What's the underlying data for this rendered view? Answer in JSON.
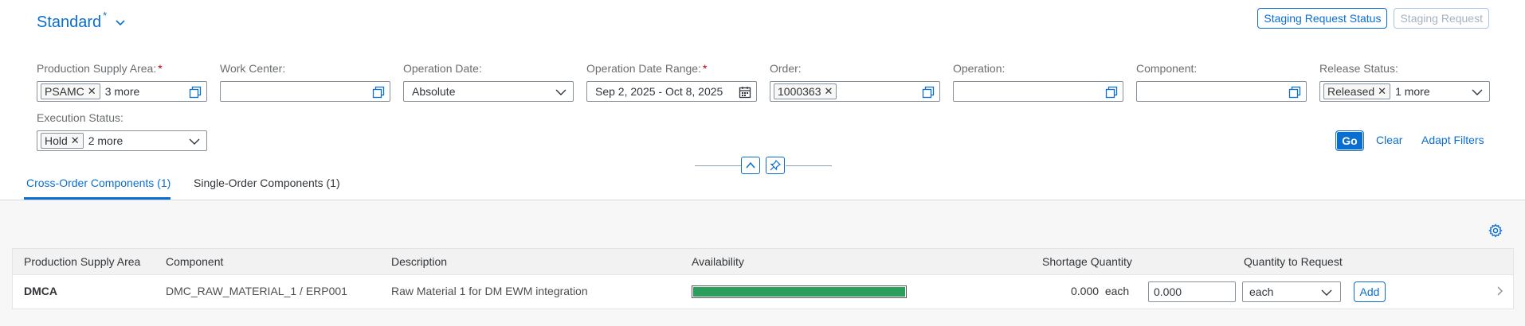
{
  "variant": {
    "title": "Standard",
    "dirty_marker": "*"
  },
  "top_actions": {
    "staging_status": "Staging Request Status",
    "staging_request": "Staging Request"
  },
  "filters": {
    "psa": {
      "label": "Production Supply Area:",
      "required": "*",
      "token": "PSAMC",
      "more": "3 more"
    },
    "work_center": {
      "label": "Work Center:",
      "value": ""
    },
    "op_date": {
      "label": "Operation Date:",
      "value": "Absolute"
    },
    "op_range": {
      "label": "Operation Date Range:",
      "required": "*",
      "value": "Sep 2, 2025 - Oct 8, 2025"
    },
    "order": {
      "label": "Order:",
      "token": "1000363"
    },
    "operation": {
      "label": "Operation:",
      "value": ""
    },
    "component": {
      "label": "Component:",
      "value": ""
    },
    "release": {
      "label": "Release Status:",
      "token": "Released",
      "more": "1 more"
    },
    "execution": {
      "label": "Execution Status:",
      "token": "Hold",
      "more": "2 more"
    }
  },
  "filter_actions": {
    "go": "Go",
    "clear": "Clear",
    "adapt": "Adapt Filters"
  },
  "tabs": [
    {
      "label": "Cross-Order Components (1)",
      "selected": true
    },
    {
      "label": "Single-Order Components (1)",
      "selected": false
    }
  ],
  "table": {
    "headers": [
      "Production Supply Area",
      "Component",
      "Description",
      "Availability",
      "Shortage Quantity",
      "Quantity to Request"
    ],
    "rows": [
      {
        "psa": "DMCA",
        "component": "DMC_RAW_MATERIAL_1 / ERP001",
        "description": "Raw Material 1 for DM EWM integration",
        "availability_fraction": 1.0,
        "shortage_qty": "0.000",
        "shortage_uom": "each",
        "request_qty": "0.000",
        "request_uom": "each",
        "add_label": "Add"
      }
    ]
  },
  "colors": {
    "accent": "#0a6ed1",
    "availability": "#2b9e5d",
    "required": "#bb0000"
  }
}
